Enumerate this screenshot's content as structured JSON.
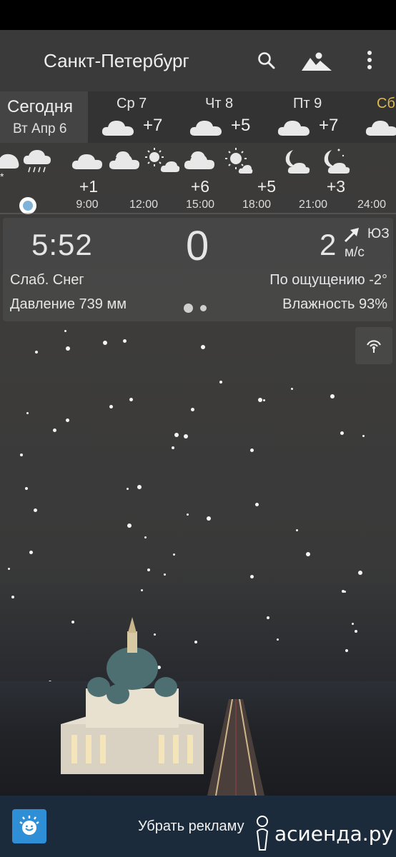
{
  "app": {
    "city": "Санкт-Петербург"
  },
  "days": {
    "today_label": "Сегодня",
    "today_date": "Вт Апр 6",
    "items": [
      {
        "name": "Ср 7",
        "temp": "+7",
        "icon": "cloud-icon"
      },
      {
        "name": "Чт 8",
        "temp": "+5",
        "icon": "cloud-icon"
      },
      {
        "name": "Пт 9",
        "temp": "+7",
        "icon": "cloud-icon"
      },
      {
        "name": "Сб",
        "temp": "",
        "icon": "cloud-icon",
        "highlight": "#e0b84a"
      }
    ]
  },
  "hourly": {
    "temps": [
      "+1",
      "+6",
      "+5",
      "+3"
    ],
    "times": [
      "9:00",
      "12:00",
      "15:00",
      "18:00",
      "21:00",
      "24:00"
    ],
    "icons": [
      "snow-cloud-icon",
      "rain-cloud-icon",
      "cloud-icon",
      "partly-cloudy-icon",
      "partly-sunny-icon",
      "cloud-icon",
      "sun-cloud-icon",
      "moon-cloud-icon",
      "moon-star-cloud-icon"
    ]
  },
  "current": {
    "time": "5:52",
    "temp": "0",
    "wind_speed": "2",
    "wind_dir": "ЮЗ",
    "wind_unit": "м/с",
    "condition": "Слаб. Снег",
    "feels_like": "По ощущению -2°",
    "pressure": "Давление 739 мм",
    "humidity": "Влажность 93%"
  },
  "ad": {
    "remove_ads": "Убрать рекламу"
  },
  "watermark": {
    "text": "асиенда.ру"
  },
  "colors": {
    "accent_day": "#e0b84a",
    "now_dot": "#7fb3d8",
    "ad_bar": "#1c2b3b",
    "logo_blue": "#2f8fd6"
  }
}
